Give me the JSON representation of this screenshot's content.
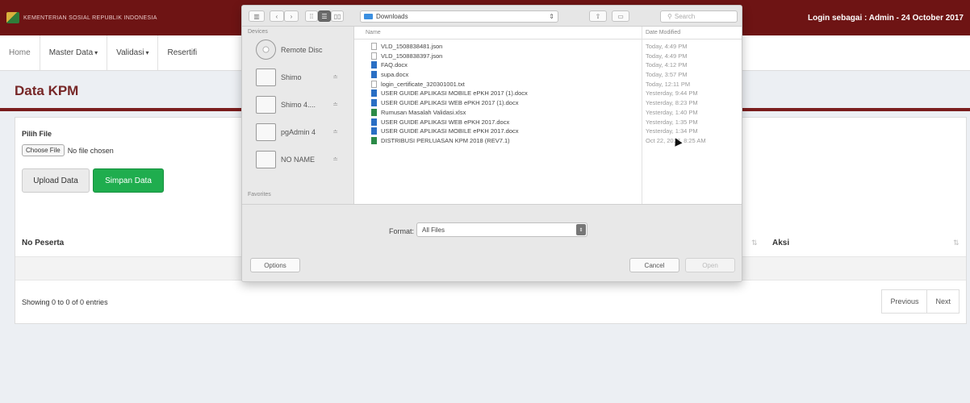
{
  "header": {
    "brand": "KEMENTERIAN SOSIAL REPUBLIK INDONESIA",
    "login_info": "Login sebagai : Admin - 24 October 2017"
  },
  "nav": {
    "items": [
      {
        "label": "Home"
      },
      {
        "label": "Master Data"
      },
      {
        "label": "Validasi"
      },
      {
        "label": "Resertifi"
      }
    ]
  },
  "page": {
    "title": "Data KPM",
    "file_label": "Pilih File",
    "choose_button": "Choose File",
    "no_file": "No file chosen",
    "upload_button": "Upload Data",
    "save_button": "Simpan Data",
    "col_peserta": "No Peserta",
    "col_aksi": "Aksi",
    "showing": "Showing 0 to 0 of 0 entries",
    "prev_button": "Previous",
    "next_button": "Next"
  },
  "dialog": {
    "location": "Downloads",
    "search_placeholder": "Search",
    "devices_label": "Devices",
    "favorites_label": "Favorites",
    "devices": [
      {
        "name": "Remote Disc",
        "ejectable": false
      },
      {
        "name": "Shimo",
        "ejectable": true
      },
      {
        "name": "Shimo 4....",
        "ejectable": true
      },
      {
        "name": "pgAdmin 4",
        "ejectable": true
      },
      {
        "name": "NO NAME",
        "ejectable": true
      }
    ],
    "col_name": "Name",
    "col_date": "Date Modified",
    "files": [
      {
        "name": "VLD_1508838481.json",
        "date": "Today, 4:49 PM",
        "type": "generic"
      },
      {
        "name": "VLD_1508838397.json",
        "date": "Today, 4:49 PM",
        "type": "generic"
      },
      {
        "name": "FAQ.docx",
        "date": "Today, 4:12 PM",
        "type": "doc"
      },
      {
        "name": "supa.docx",
        "date": "Today, 3:57 PM",
        "type": "doc"
      },
      {
        "name": "login_certificate_320301001.txt",
        "date": "Today, 12:11 PM",
        "type": "generic"
      },
      {
        "name": "USER GUIDE APLIKASI MOBILE ePKH 2017 (1).docx",
        "date": "Yesterday, 9:44 PM",
        "type": "doc"
      },
      {
        "name": "USER GUIDE APLIKASI WEB ePKH 2017 (1).docx",
        "date": "Yesterday, 8:23 PM",
        "type": "doc"
      },
      {
        "name": "Rumusan Masalah Validasi.xlsx",
        "date": "Yesterday, 1:40 PM",
        "type": "xls"
      },
      {
        "name": "USER GUIDE APLIKASI WEB ePKH 2017.docx",
        "date": "Yesterday, 1:35 PM",
        "type": "doc"
      },
      {
        "name": "USER GUIDE APLIKASI MOBILE ePKH 2017.docx",
        "date": "Yesterday, 1:34 PM",
        "type": "doc"
      },
      {
        "name": "DISTRIBUSI PERLUASAN KPM 2018 (REV7.1)",
        "date": "Oct 22, 2017, 8:25 AM",
        "type": "xls"
      }
    ],
    "format_label": "Format:",
    "format_value": "All Files",
    "options_button": "Options",
    "cancel_button": "Cancel",
    "open_button": "Open"
  }
}
